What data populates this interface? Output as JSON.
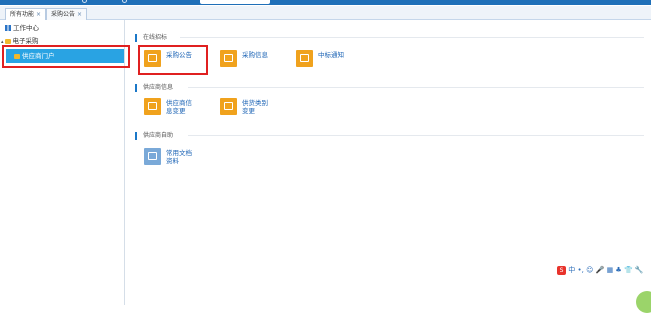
{
  "tabs": [
    {
      "label": "所有功能",
      "close": "×",
      "active": true
    },
    {
      "label": "采购公告",
      "close": "×",
      "active": false
    }
  ],
  "sidebar": {
    "items": [
      {
        "label": "工作中心",
        "icon": "grid-icon"
      },
      {
        "label": "电子采购",
        "icon": "folder-icon",
        "expand": "▴"
      },
      {
        "label": "供应商门户",
        "icon": "folder-icon",
        "selected": true
      }
    ]
  },
  "sections": [
    {
      "title": "在线招标",
      "tiles": [
        {
          "label": "采购公告",
          "icon": "cart-icon",
          "highlighted": true
        },
        {
          "label": "采购信息",
          "icon": "cart-icon"
        },
        {
          "label": "中标通知",
          "icon": "clipboard-check-icon"
        }
      ]
    },
    {
      "title": "供应商信息",
      "tiles": [
        {
          "label": "供应商信息变更",
          "icon": "document-edit-icon"
        },
        {
          "label": "供货类别变更",
          "icon": "cart-icon"
        }
      ]
    },
    {
      "title": "供应商自助",
      "tiles": [
        {
          "label": "常用文档资料",
          "icon": "document-stack-icon"
        }
      ]
    }
  ],
  "tray": {
    "ime_label": "S",
    "items": [
      "中",
      "•,",
      "☺",
      "🎤",
      "▦",
      "♣",
      "👕",
      "🔧"
    ]
  },
  "colors": {
    "accent": "#1f6fb8",
    "tile_orange": "#f0a21d",
    "tile_blue": "#7aa9d8",
    "highlight_red": "#e02020",
    "selection": "#29a3e3"
  }
}
